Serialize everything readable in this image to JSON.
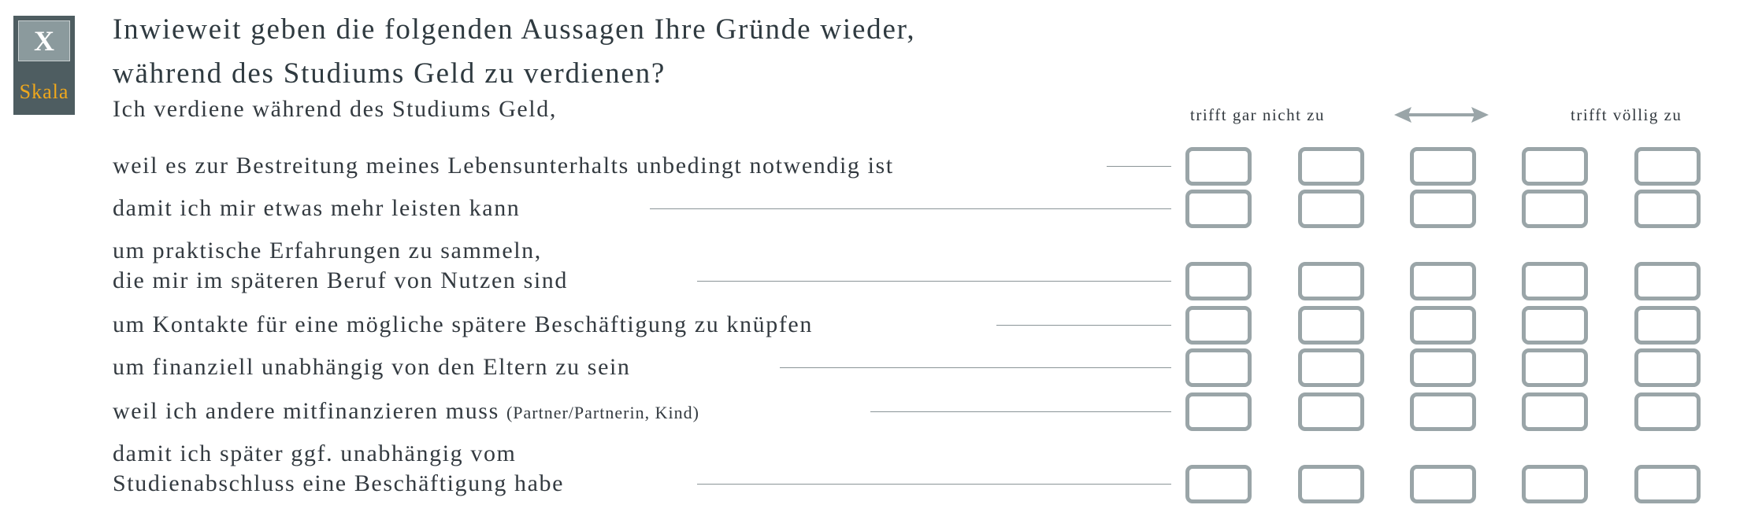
{
  "badge": {
    "icon_text": "X",
    "label": "Skala"
  },
  "question": {
    "lines": [
      "Inwieweit geben die folgenden Aussagen Ihre Gründe wieder,",
      "während des Studiums Geld zu verdienen?"
    ],
    "intro": "Ich verdiene während des Studiums Geld,"
  },
  "scale": {
    "left_label": "trifft gar nicht zu",
    "right_label": "trifft völlig zu",
    "points": 5
  },
  "items": [
    {
      "lines": [
        "weil es zur Bestreitung meines Lebensunterhalts unbedingt notwendig ist"
      ],
      "note": ""
    },
    {
      "lines": [
        "damit ich mir etwas mehr leisten kann"
      ],
      "note": ""
    },
    {
      "lines": [
        "um praktische Erfahrungen zu sammeln,",
        "die mir im späteren Beruf von Nutzen sind"
      ],
      "note": ""
    },
    {
      "lines": [
        "um Kontakte für eine mögliche spätere Beschäftigung zu knüpfen"
      ],
      "note": ""
    },
    {
      "lines": [
        "um finanziell unabhängig von den Eltern zu sein"
      ],
      "note": ""
    },
    {
      "lines": [
        "weil ich andere mitfinanzieren muss"
      ],
      "note": "(Partner/Partnerin, Kind)"
    },
    {
      "lines": [
        "damit ich später ggf. unabhängig vom",
        "Studienabschluss eine Beschäftigung habe"
      ],
      "note": ""
    }
  ],
  "colors": {
    "badge_bg": "#4e5d61",
    "badge_box": "#8b9a9d",
    "badge_label": "#f0a81c",
    "checkbox_border": "#9aa5a8",
    "text": "#333a40"
  }
}
